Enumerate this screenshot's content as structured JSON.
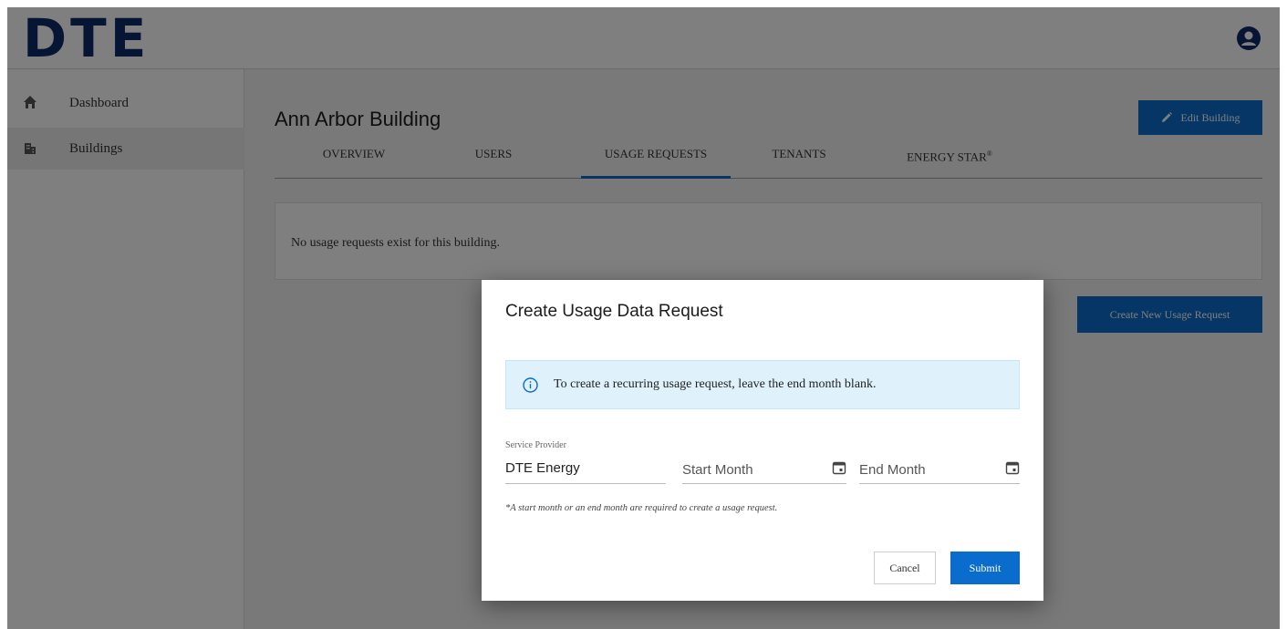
{
  "header": {
    "logo_text": "DTE",
    "user_icon": "user-circle-icon"
  },
  "sidebar": {
    "items": [
      {
        "label": "Dashboard",
        "icon": "home-icon",
        "active": false
      },
      {
        "label": "Buildings",
        "icon": "building-icon",
        "active": true
      }
    ]
  },
  "main": {
    "title": "Ann Arbor Building",
    "edit_button": "Edit Building",
    "tabs": [
      {
        "label": "OVERVIEW"
      },
      {
        "label": "USERS"
      },
      {
        "label": "USAGE REQUESTS",
        "active": true
      },
      {
        "label": "TENANTS"
      },
      {
        "label": "ENERGY STAR",
        "sup": "®"
      }
    ],
    "empty_message": "No usage requests exist for this building.",
    "create_button": "Create New Usage Request"
  },
  "modal": {
    "title": "Create Usage Data Request",
    "info_text": "To create a recurring usage request, leave the end month blank.",
    "service_provider_label": "Service Provider",
    "service_provider_value": "DTE Energy",
    "start_month_placeholder": "Start Month",
    "end_month_placeholder": "End Month",
    "note": "*A start month or an end month are required to create a usage request.",
    "cancel_label": "Cancel",
    "submit_label": "Submit"
  },
  "colors": {
    "brand": "#0b2a67",
    "primary": "#0a6ccc",
    "info_bg": "#dff1fb"
  }
}
